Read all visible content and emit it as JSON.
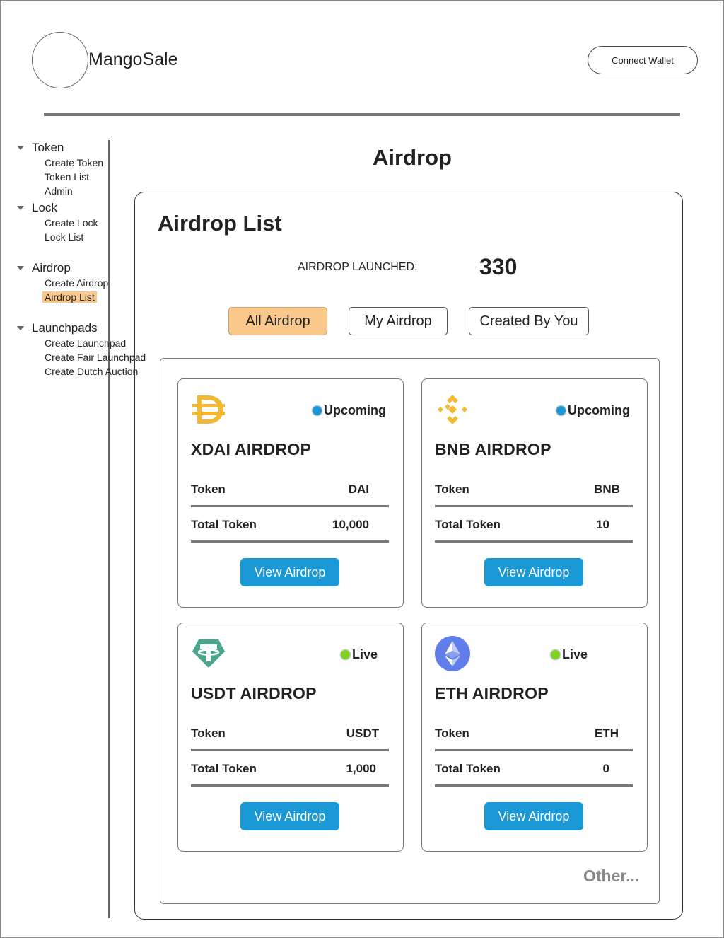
{
  "header": {
    "brand": "MangoSale",
    "connect_wallet": "Connect Wallet"
  },
  "sidebar": {
    "sections": [
      {
        "label": "Token",
        "items": [
          "Create Token",
          "Token List",
          "Admin"
        ]
      },
      {
        "label": "Lock",
        "items": [
          "Create Lock",
          "Lock List"
        ]
      },
      {
        "label": "Airdrop",
        "items": [
          "Create Airdrop",
          "Airdrop List"
        ]
      },
      {
        "label": "Launchpads",
        "items": [
          "Create Launchpad",
          "Create Fair Launchpad",
          "Create Dutch Auction"
        ]
      }
    ],
    "active_item": "Airdrop List"
  },
  "main": {
    "page_title": "Airdrop",
    "panel_title": "Airdrop List",
    "launched_label": "AIRDROP LAUNCHED:",
    "launched_count": "330",
    "tabs": [
      {
        "label": "All Airdrop",
        "active": true
      },
      {
        "label": "My Airdrop",
        "active": false
      },
      {
        "label": "Created By You",
        "active": false
      }
    ],
    "cards": [
      {
        "icon": "dai-icon",
        "status": "Upcoming",
        "status_color": "#1a97d5",
        "name": "XDAI AIRDROP",
        "token_label": "Token",
        "token": "DAI",
        "total_label": "Total Token",
        "total": "10,000",
        "button": "View Airdrop"
      },
      {
        "icon": "bnb-icon",
        "status": "Upcoming",
        "status_color": "#1a97d5",
        "name": "BNB AIRDROP",
        "token_label": "Token",
        "token": "BNB",
        "total_label": "Total Token",
        "total": "10",
        "button": "View Airdrop"
      },
      {
        "icon": "usdt-icon",
        "status": "Live",
        "status_color": "#7ed321",
        "name": "USDT AIRDROP",
        "token_label": "Token",
        "token": "USDT",
        "total_label": "Total Token",
        "total": "1,000",
        "button": "View Airdrop"
      },
      {
        "icon": "eth-icon",
        "status": "Live",
        "status_color": "#7ed321",
        "name": "ETH AIRDROP",
        "token_label": "Token",
        "token": "ETH",
        "total_label": "Total Token",
        "total": "0",
        "button": "View Airdrop"
      }
    ],
    "other_link": "Other..."
  },
  "colors": {
    "accent": "#f9c88a",
    "button_blue": "#1a97d5",
    "upcoming": "#1a97d5",
    "live": "#7ed321"
  }
}
